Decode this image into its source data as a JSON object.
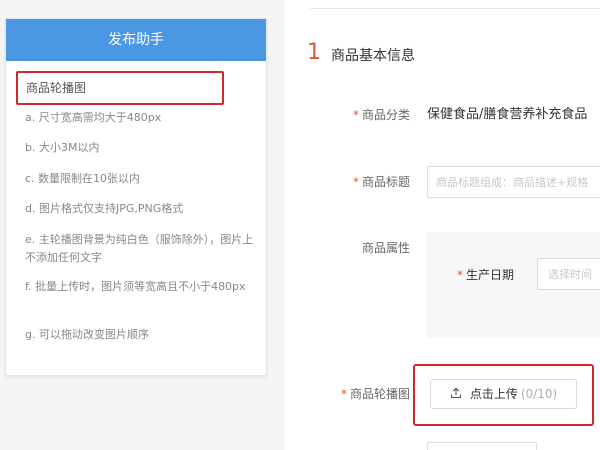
{
  "helper": {
    "title": "发布助手",
    "section_title": "商品轮播图",
    "items": [
      "a. 尺寸宽高需均大于480px",
      "b. 大小3M以内",
      "c. 数量限制在10张以内",
      "d. 图片格式仅支持JPG,PNG格式",
      "e. 主轮播图背景为纯白色（服饰除外），图片上不添加任何文字",
      "f. 批量上传时，图片须等宽高且不小于480px",
      "g. 可以拖动改变图片顺序"
    ]
  },
  "form": {
    "section_number": "1",
    "section_title": "商品基本信息",
    "required_mark": "*",
    "category": {
      "label": "商品分类",
      "value": "保健食品/膳食营养补充食品"
    },
    "product_title": {
      "label": "商品标题",
      "placeholder": "商品标题组成：商品描述+规格"
    },
    "attributes": {
      "label": "商品属性",
      "production_date": {
        "label": "生产日期",
        "placeholder": "选择时间"
      }
    },
    "carousel": {
      "label": "商品轮播图",
      "upload_label": "点击上传",
      "upload_count": "(0/10)"
    }
  }
}
